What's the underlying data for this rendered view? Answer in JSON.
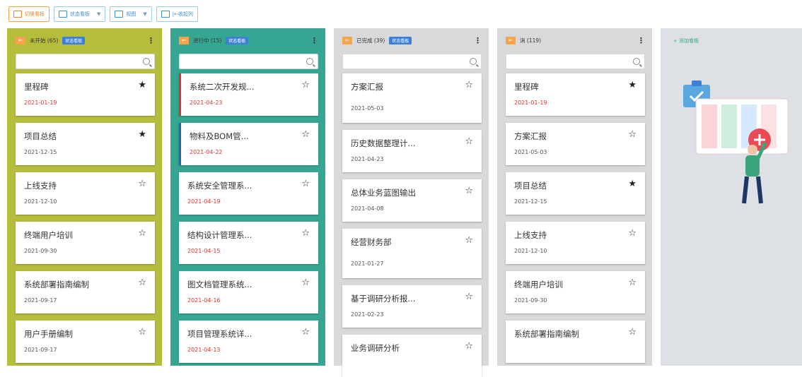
{
  "toolbar": {
    "buttons": [
      {
        "label": "切换看板",
        "icon": "board-icon",
        "style": "orange"
      },
      {
        "label": "状态看板",
        "icon": "board-icon",
        "style": "blue",
        "dropdown": true
      },
      {
        "label": "视图",
        "icon": "board-icon",
        "style": "blue",
        "dropdown": true
      },
      {
        "label": "|←收起列",
        "icon": "collapse-icon",
        "style": "blue"
      }
    ]
  },
  "columns": [
    {
      "title": "未开始 (65)",
      "badge": "状态看板",
      "color": "#b6bd3c",
      "search_placeholder": "",
      "cards": [
        {
          "title": "里程碑",
          "date": "2021-01-19",
          "overdue": true,
          "starred": true
        },
        {
          "title": "项目总结",
          "date": "2021-12-15",
          "overdue": false,
          "starred": true
        },
        {
          "title": "上线支持",
          "date": "2021-12-10",
          "overdue": false,
          "starred": false
        },
        {
          "title": "终端用户培训",
          "date": "2021-09-30",
          "overdue": false,
          "starred": false
        },
        {
          "title": "系统部署指南编制",
          "date": "2021-09-17",
          "overdue": false,
          "starred": false
        },
        {
          "title": "用户手册编制",
          "date": "2021-09-17",
          "overdue": false,
          "starred": false
        }
      ]
    },
    {
      "title": "进行中 (15)",
      "badge": "状态看板",
      "color": "#36a692",
      "search_placeholder": "",
      "cards": [
        {
          "title": "系统二次开发规...",
          "date": "2021-04-23",
          "overdue": true,
          "starred": false,
          "bar": "red"
        },
        {
          "title": "物料及BOM管...",
          "date": "2021-04-22",
          "overdue": true,
          "starred": false,
          "bar": "blue"
        },
        {
          "title": "系统安全管理系...",
          "date": "2021-04-19",
          "overdue": true,
          "starred": false
        },
        {
          "title": "结构设计管理系...",
          "date": "2021-04-15",
          "overdue": true,
          "starred": false
        },
        {
          "title": "图文档管理系统...",
          "date": "2021-04-16",
          "overdue": true,
          "starred": false
        },
        {
          "title": "项目管理系统详...",
          "date": "2021-04-13",
          "overdue": true,
          "starred": false
        }
      ]
    },
    {
      "title": "已完成 (39)",
      "badge": "状态看板",
      "color": "#d8d9db",
      "search_placeholder": "",
      "cards": [
        {
          "title": "方案汇报",
          "date": "2021-05-03",
          "overdue": false,
          "starred": false,
          "tall": true
        },
        {
          "title": "历史数据整理计...",
          "date": "2021-04-23",
          "overdue": false,
          "starred": false
        },
        {
          "title": "总体业务蓝图输出",
          "date": "2021-04-08",
          "overdue": false,
          "starred": false
        },
        {
          "title": "经营财务部",
          "date": "2021-01-27",
          "overdue": false,
          "starred": false,
          "tall": true
        },
        {
          "title": "基于调研分析报...",
          "date": "2021-02-23",
          "overdue": false,
          "starred": false
        },
        {
          "title": "业务调研分析",
          "date": "",
          "overdue": false,
          "starred": false
        }
      ]
    },
    {
      "title": "消 (119)",
      "badge": "",
      "color": "#d8d9db",
      "search_placeholder": "",
      "cards": [
        {
          "title": "里程碑",
          "date": "2021-01-19",
          "overdue": true,
          "starred": true
        },
        {
          "title": "方案汇报",
          "date": "2021-05-03",
          "overdue": false,
          "starred": false
        },
        {
          "title": "项目总结",
          "date": "2021-12-15",
          "overdue": false,
          "starred": true
        },
        {
          "title": "上线支持",
          "date": "2021-12-10",
          "overdue": false,
          "starred": false
        },
        {
          "title": "终端用户培训",
          "date": "2021-09-30",
          "overdue": false,
          "starred": false
        },
        {
          "title": "系统部署指南编制",
          "date": "",
          "overdue": false,
          "starred": false
        }
      ]
    }
  ],
  "add_column": {
    "label": "+ 添加看板"
  },
  "icons": {
    "collapse": "collapse-arrow-icon",
    "menu": "kebab-menu-icon",
    "search": "search-icon",
    "star_filled": "star-filled-icon",
    "star_empty": "star-outline-icon"
  },
  "colors": {
    "overdue": "#e0322c",
    "accent_blue": "#3d7fd6",
    "orange": "#f7a34b"
  }
}
